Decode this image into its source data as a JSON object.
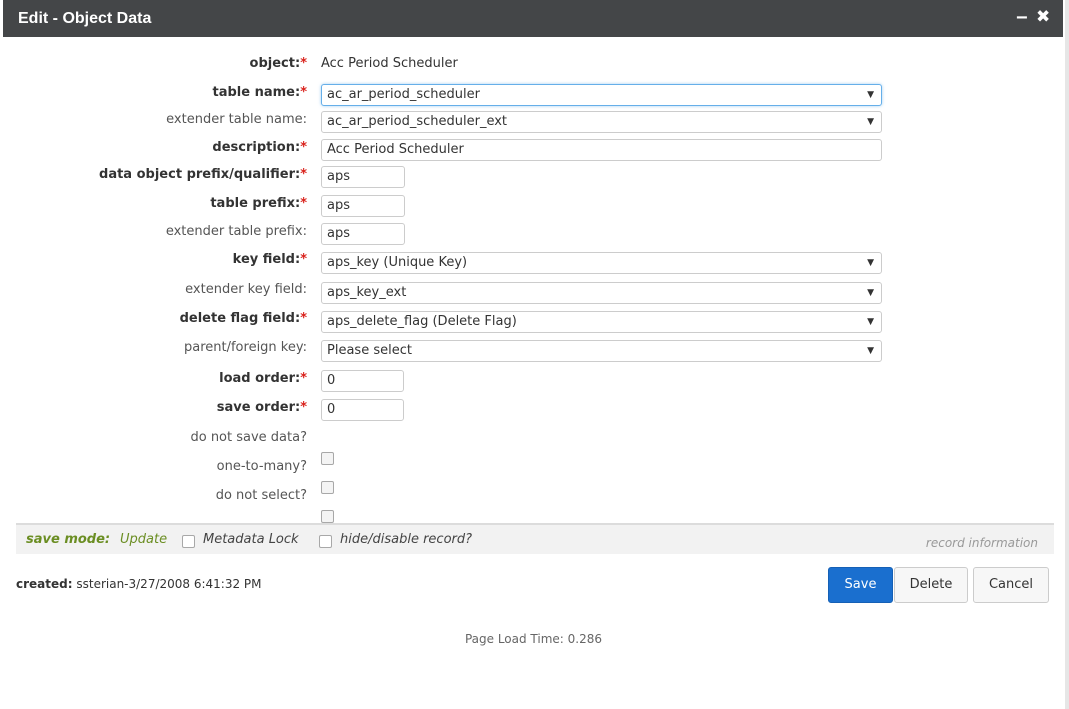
{
  "window": {
    "title": "Edit - Object Data",
    "minimize_glyph": "‒",
    "close_glyph": "✖"
  },
  "fields": {
    "object": {
      "label": "object:",
      "value": "Acc Period Scheduler"
    },
    "table_name": {
      "label": "table name:",
      "value": "ac_ar_period_scheduler"
    },
    "extender_table_name": {
      "label": "extender table name:",
      "value": "ac_ar_period_scheduler_ext"
    },
    "description": {
      "label": "description:",
      "value": "Acc Period Scheduler"
    },
    "data_object_prefix": {
      "label": "data object prefix/qualifier:",
      "value": "aps"
    },
    "table_prefix": {
      "label": "table prefix:",
      "value": "aps"
    },
    "extender_table_prefix": {
      "label": "extender table prefix:",
      "value": "aps"
    },
    "key_field": {
      "label": "key field:",
      "value": "aps_key (Unique Key)"
    },
    "extender_key_field": {
      "label": "extender key field:",
      "value": "aps_key_ext"
    },
    "delete_flag_field": {
      "label": "delete flag field:",
      "value": "aps_delete_flag (Delete Flag)"
    },
    "parent_foreign_key": {
      "label": "parent/foreign key:",
      "value": "Please select"
    },
    "load_order": {
      "label": "load order:",
      "value": "0"
    },
    "save_order": {
      "label": "save order:",
      "value": "0"
    },
    "do_not_save_data": {
      "label": "do not save data?"
    },
    "one_to_many": {
      "label": "one-to-many?"
    },
    "do_not_select": {
      "label": "do not select?"
    }
  },
  "required_star": "*",
  "caret_glyph": "▼",
  "footer_bar": {
    "save_mode_label": "save mode:",
    "save_mode_value": "Update",
    "metadata_lock_label": "Metadata Lock",
    "hide_disable_label": "hide/disable record?",
    "record_information": "record information"
  },
  "created": {
    "label": "created:",
    "value": "ssterian-3/27/2008 6:41:32 PM"
  },
  "buttons": {
    "save": "Save",
    "delete": "Delete",
    "cancel": "Cancel"
  },
  "page_load_time": "Page Load Time: 0.286",
  "colors": {
    "titlebar": "#444648",
    "required": "#d9221c",
    "primary_button": "#1a6fcf",
    "save_mode": "#6b8e23"
  }
}
